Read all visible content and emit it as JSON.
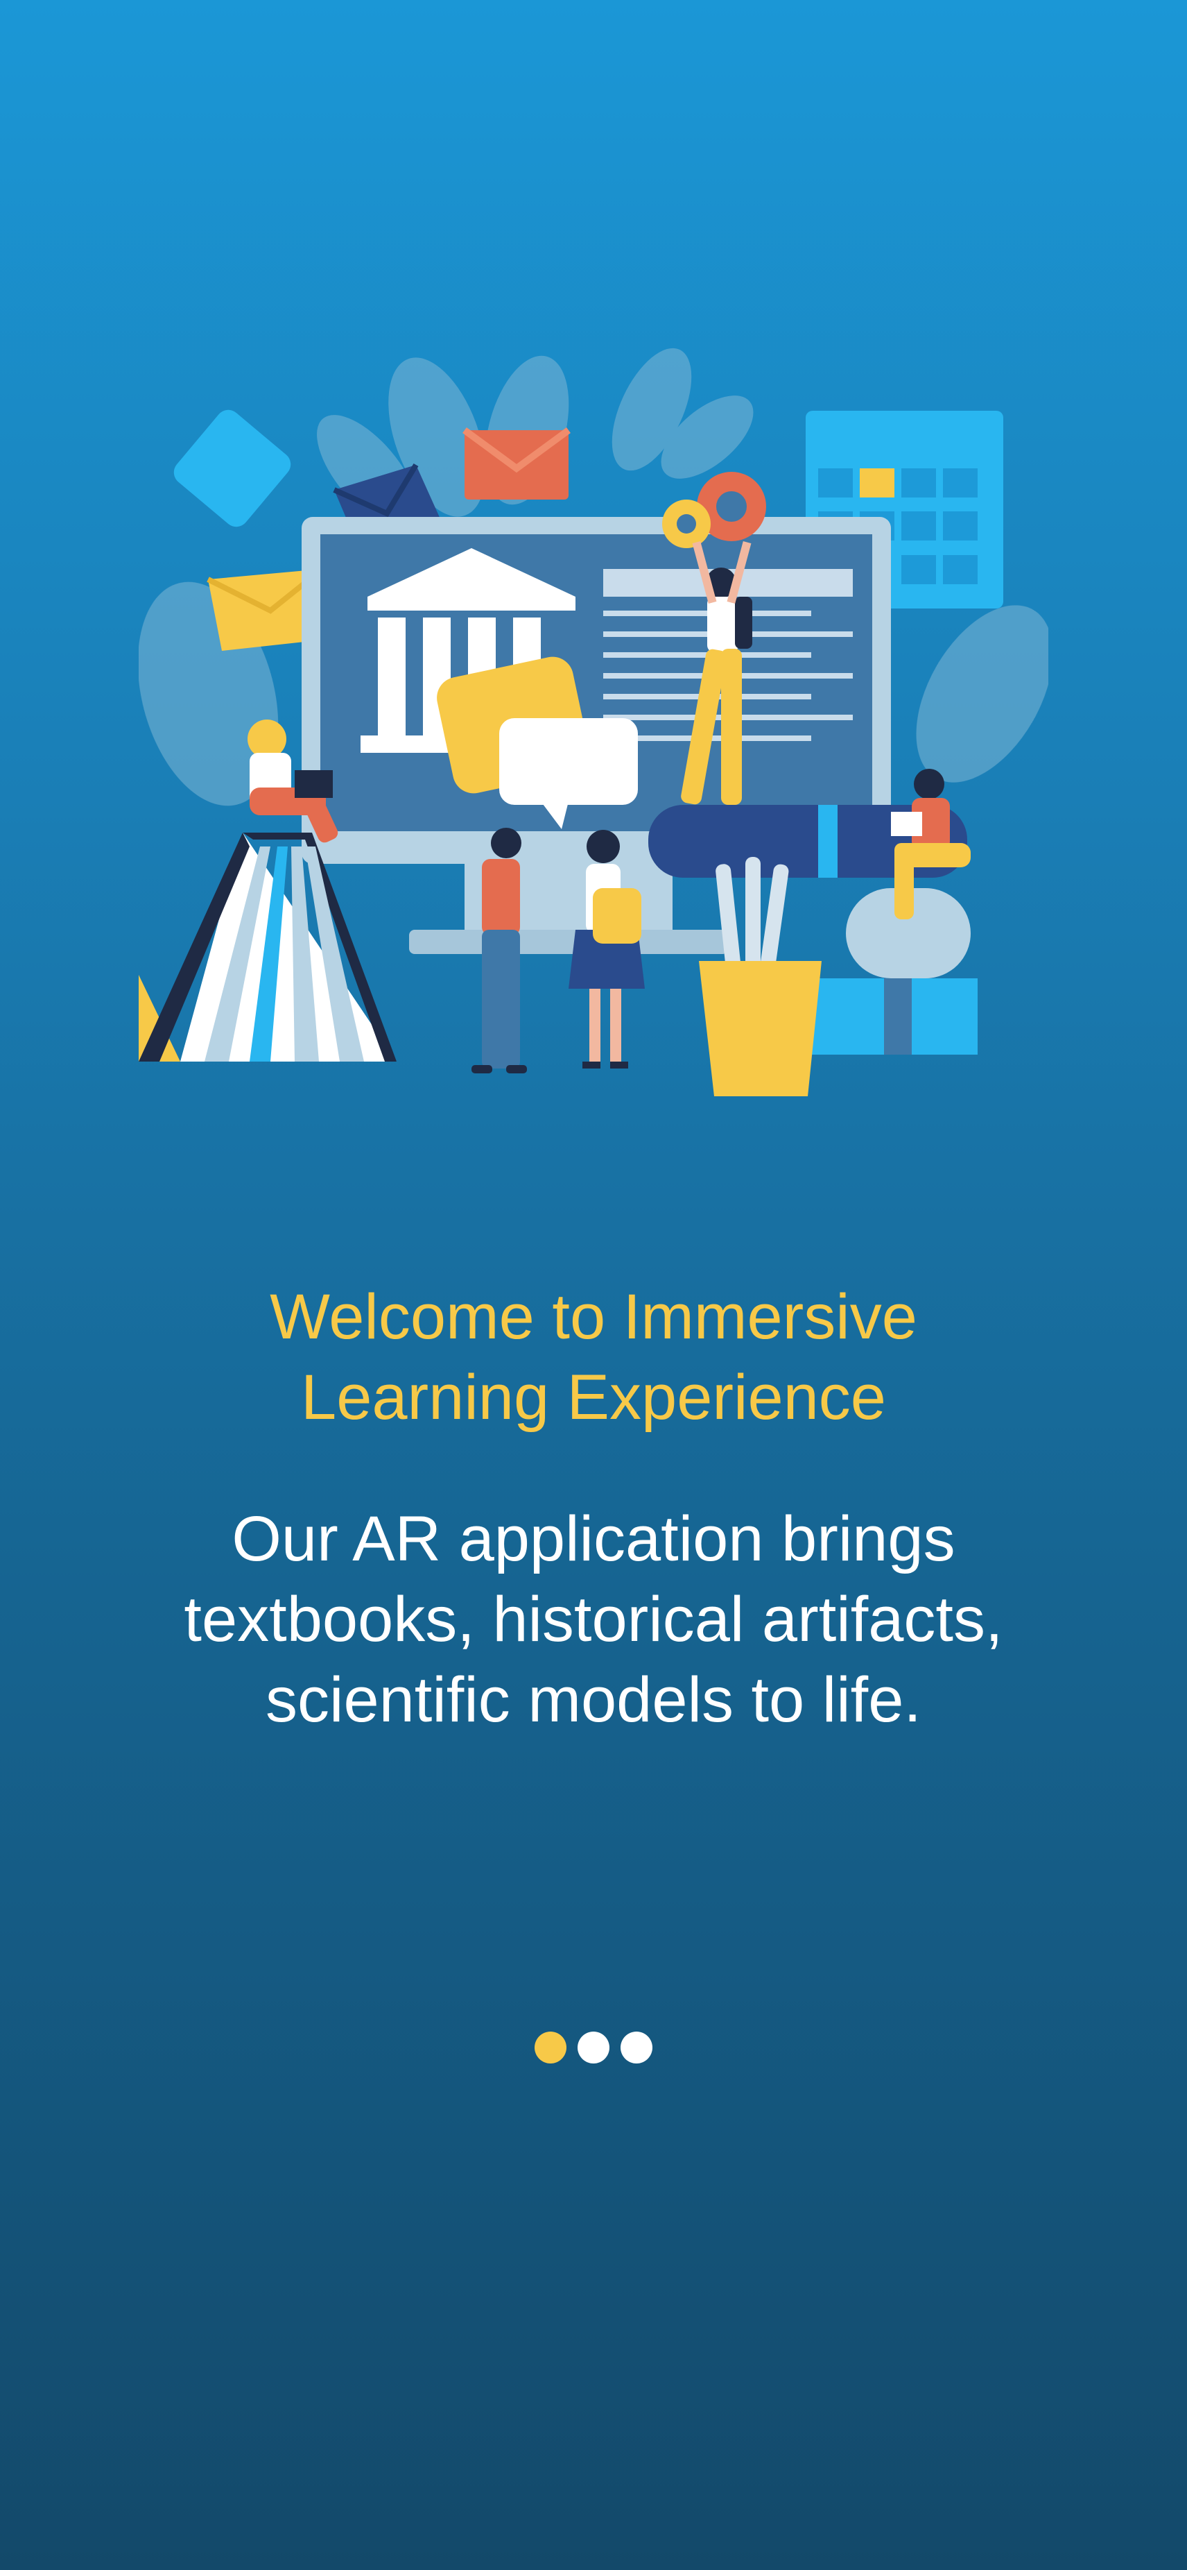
{
  "onboarding": {
    "title_lines": [
      "Welcome to Immersive",
      "Learning Experience"
    ],
    "description_lines": [
      "Our AR application brings",
      "textbooks, historical artifacts,",
      "scientific models to life."
    ],
    "pager": {
      "total": 3,
      "active_index": 0
    }
  },
  "colors": {
    "title": "#f7c948",
    "text": "#ffffff",
    "dot_active": "#f7c948",
    "dot_inactive": "#ffffff",
    "background_top": "#1b97d6",
    "background_bottom": "#13496a"
  },
  "illustration": {
    "name": "education-illustration"
  }
}
